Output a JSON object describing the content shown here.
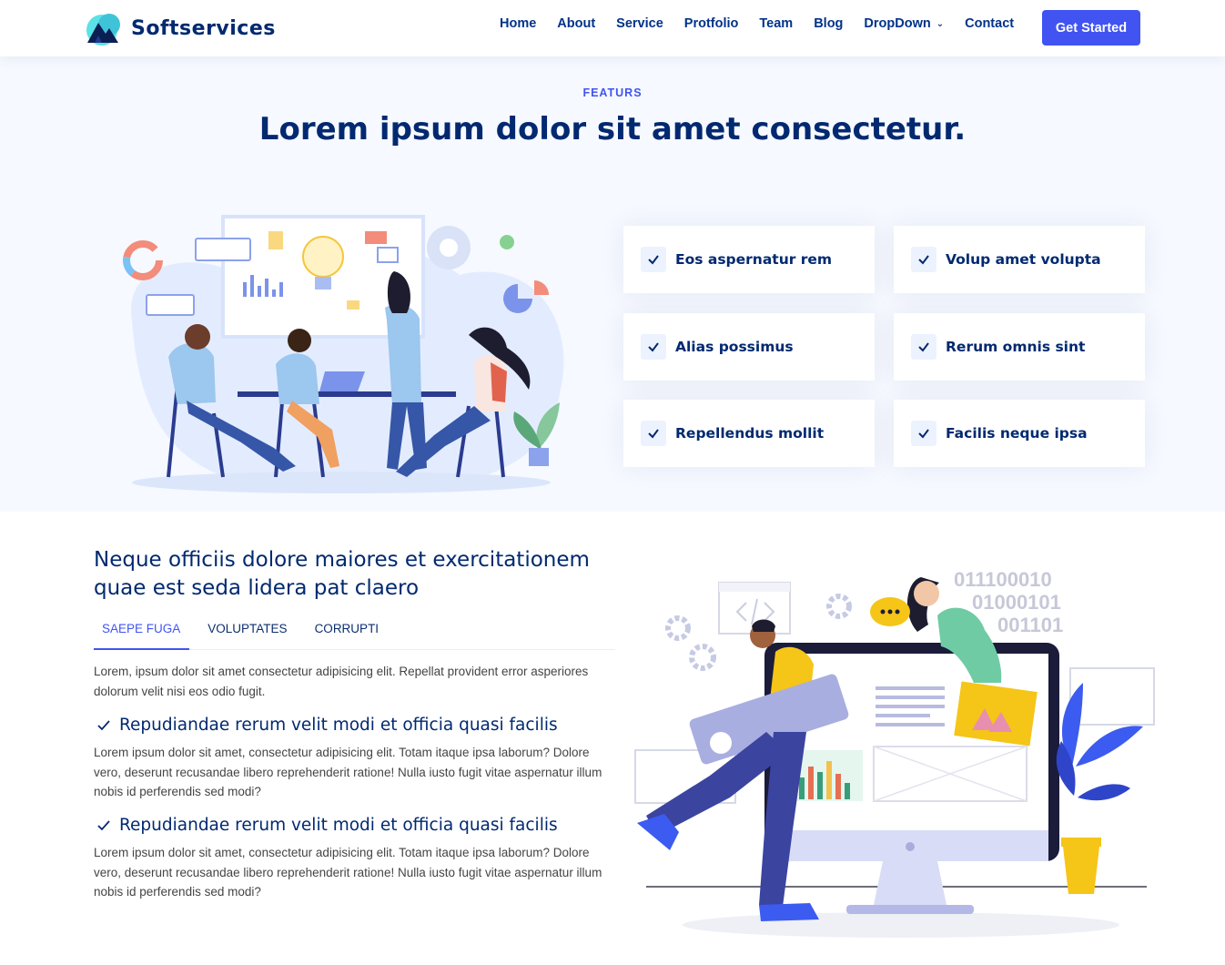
{
  "header": {
    "brand": "Softservices",
    "nav": [
      "Home",
      "About",
      "Service",
      "Protfolio",
      "Team",
      "Blog",
      "DropDown",
      "Contact"
    ],
    "cta": "Get Started",
    "icons": {
      "dropdown": "chevron-down-icon",
      "logo": "mountain-logo-icon"
    }
  },
  "features": {
    "eyebrow": "FEATURS",
    "title": "Lorem ipsum dolor sit amet consectetur.",
    "items": [
      "Eos aspernatur rem",
      "Volup amet volupta",
      "Alias possimus",
      "Rerum omnis sint",
      "Repellendus mollit",
      "Facilis neque ipsa"
    ]
  },
  "tabs_section": {
    "title": "Neque officiis dolore maiores et exercitationem quae est seda lidera pat claero",
    "tabs": [
      "SAEPE FUGA",
      "VOLUPTATES",
      "CORRUPTI"
    ],
    "active_tab": "SAEPE FUGA",
    "intro": "Lorem, ipsum dolor sit amet consectetur adipisicing elit. Repellat provident error asperiores dolorum velit nisi eos odio fugit.",
    "blocks": [
      {
        "heading": "Repudiandae rerum velit modi et officia quasi facilis",
        "body": "Lorem ipsum dolor sit amet, consectetur adipisicing elit. Totam itaque ipsa laborum? Dolore vero, deserunt recusandae libero reprehenderit ratione! Nulla iusto fugit vitae aspernatur illum nobis id perferendis sed modi?"
      },
      {
        "heading": "Repudiandae rerum velit modi et officia quasi facilis",
        "body": "Lorem ipsum dolor sit amet, consectetur adipisicing elit. Totam itaque ipsa laborum? Dolore vero, deserunt recusandae libero reprehenderit ratione! Nulla iusto fugit vitae aspernatur illum nobis id perferendis sed modi?"
      }
    ],
    "illustration_text": [
      "011100010",
      "01000101",
      "001101"
    ]
  },
  "colors": {
    "primary": "#4154f1",
    "navy": "#012970",
    "section_bg": "#f6f9ff"
  }
}
